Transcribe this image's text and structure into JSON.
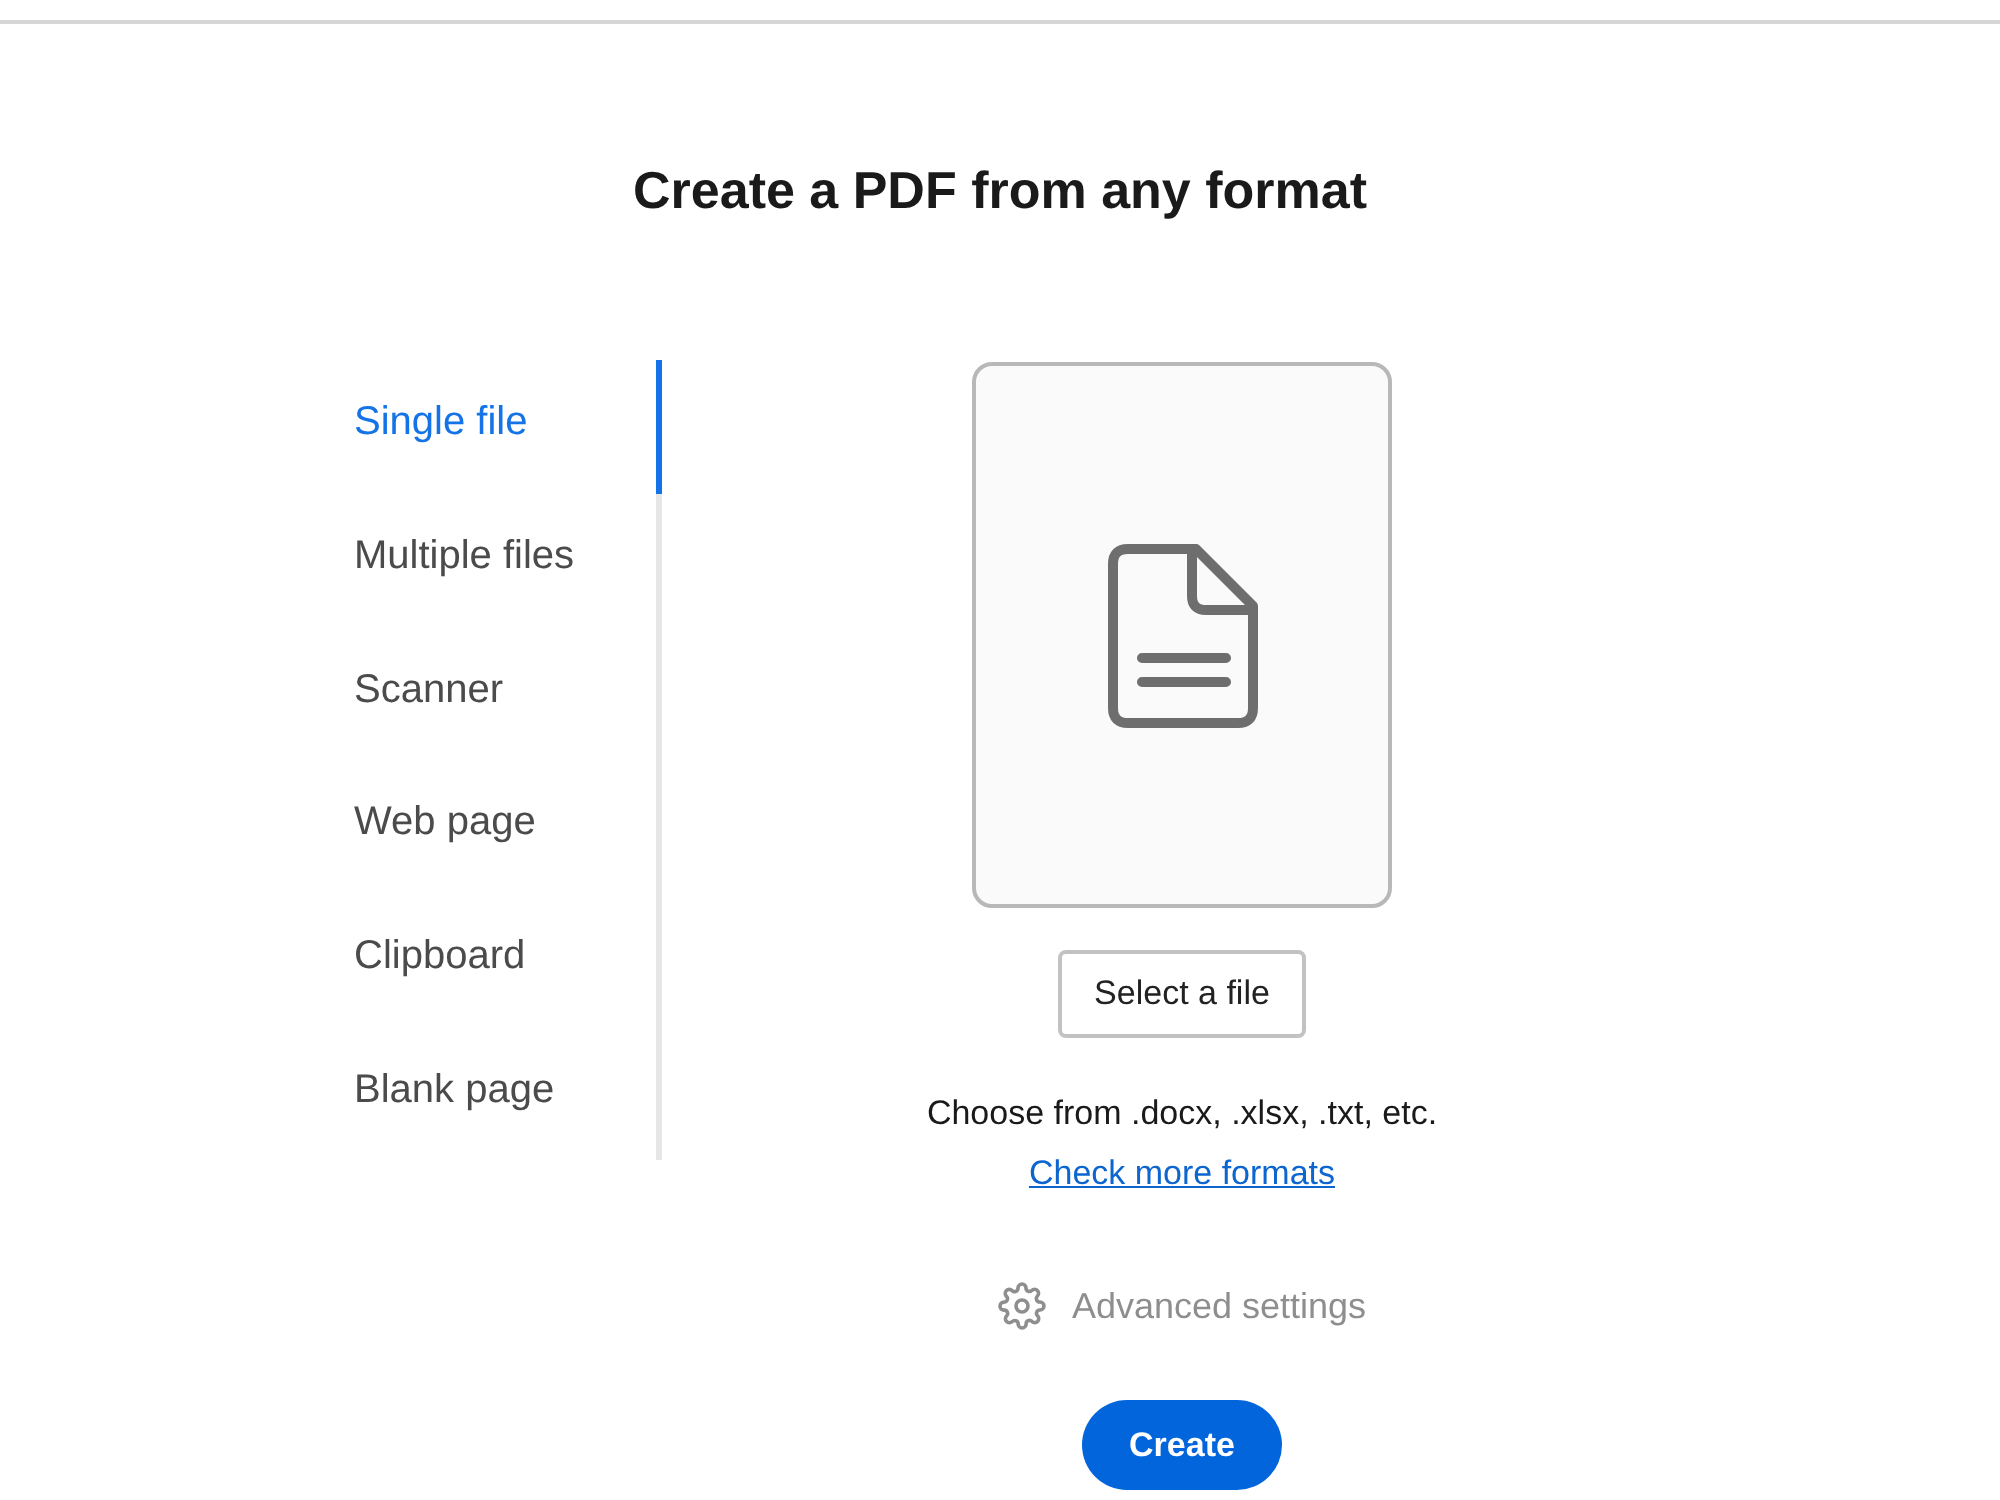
{
  "title": "Create a PDF from any format",
  "sidebar": {
    "items": [
      {
        "label": "Single file",
        "selected": true
      },
      {
        "label": "Multiple files",
        "selected": false
      },
      {
        "label": "Scanner",
        "selected": false
      },
      {
        "label": "Web page",
        "selected": false
      },
      {
        "label": "Clipboard",
        "selected": false
      },
      {
        "label": "Blank page",
        "selected": false
      }
    ]
  },
  "drop_zone": {
    "select_button": "Select a file"
  },
  "hint": "Choose from .docx, .xlsx, .txt, etc.",
  "link": "Check more formats",
  "advanced_settings": {
    "label": "Advanced settings",
    "disabled": true
  },
  "create_button": "Create"
}
